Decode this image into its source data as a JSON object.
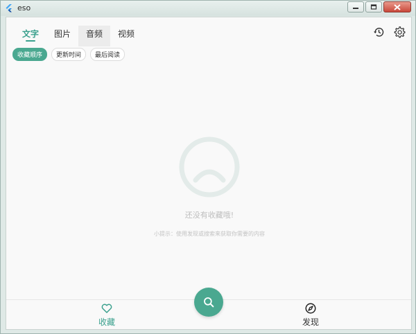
{
  "window": {
    "title": "eso"
  },
  "tabs": [
    {
      "label": "文字"
    },
    {
      "label": "图片"
    },
    {
      "label": "音频"
    },
    {
      "label": "视频"
    }
  ],
  "sort_chips": [
    {
      "label": "收藏顺序"
    },
    {
      "label": "更新时间"
    },
    {
      "label": "最后阅读"
    }
  ],
  "empty_state": {
    "title": "还没有收藏哦!",
    "hint": "小提示：使用发现或搜索来获取你需要的内容"
  },
  "bottom_nav": {
    "favorites": "收藏",
    "discover": "发现"
  },
  "colors": {
    "accent": "#4aa890"
  },
  "icons": {
    "app": "flutter-icon",
    "history": "history-icon",
    "settings": "gear-icon",
    "search": "search-icon",
    "favorites": "heart-icon",
    "discover": "compass-icon"
  }
}
